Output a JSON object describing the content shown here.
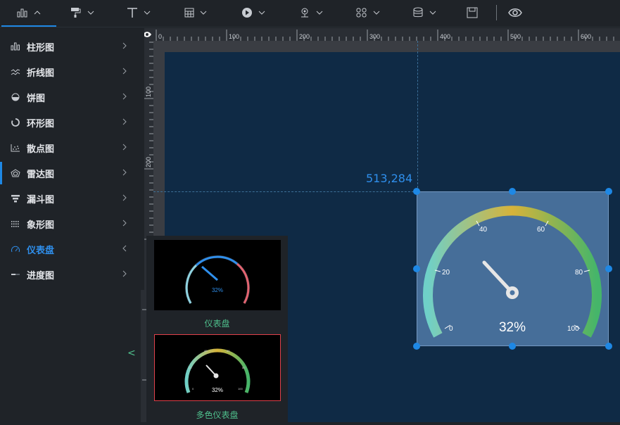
{
  "toolbar": {
    "items": [
      {
        "icon": "bar-chart-icon",
        "active": true
      },
      {
        "icon": "paint-roller-icon"
      },
      {
        "icon": "text-icon"
      },
      {
        "icon": "table-icon"
      },
      {
        "icon": "media-play-icon"
      },
      {
        "icon": "map-pin-icon"
      },
      {
        "icon": "widget-icon"
      },
      {
        "icon": "database-icon"
      },
      {
        "icon": "save-icon"
      },
      {
        "icon": "eye-icon"
      }
    ]
  },
  "menu": {
    "items": [
      {
        "label": "柱形图",
        "icon": "bar-chart-icon"
      },
      {
        "label": "折线图",
        "icon": "line-chart-icon"
      },
      {
        "label": "饼图",
        "icon": "pie-chart-icon"
      },
      {
        "label": "环形图",
        "icon": "ring-chart-icon"
      },
      {
        "label": "散点图",
        "icon": "scatter-chart-icon"
      },
      {
        "label": "雷达图",
        "icon": "radar-chart-icon"
      },
      {
        "label": "漏斗图",
        "icon": "funnel-chart-icon"
      },
      {
        "label": "象形图",
        "icon": "pictorial-chart-icon"
      },
      {
        "label": "仪表盘",
        "icon": "gauge-icon",
        "active": true
      },
      {
        "label": "进度图",
        "icon": "progress-chart-icon"
      }
    ]
  },
  "ruler": {
    "top_labels": [
      "0",
      "100",
      "200",
      "300",
      "400",
      "500",
      "600"
    ],
    "left_labels": [
      "100",
      "200"
    ]
  },
  "canvas": {
    "cursor_coords": "513,284"
  },
  "gauge_widget": {
    "value_text": "32%",
    "ticks": [
      "0",
      "20",
      "40",
      "60",
      "80",
      "100"
    ]
  },
  "popup": {
    "gauge_thumbnail_label": "仪表盘",
    "gauge_thumbnail_value": "32%",
    "multicolor_thumbnail_label": "多色仪表盘",
    "multicolor_thumbnail_value": "32%",
    "multicolor_ticks": [
      "0",
      "20",
      "40",
      "60",
      "80",
      "100"
    ]
  },
  "colors": {
    "accent": "#1e88e5",
    "canvas_bg": "#0f2a45",
    "label_green": "#4fc08d"
  }
}
